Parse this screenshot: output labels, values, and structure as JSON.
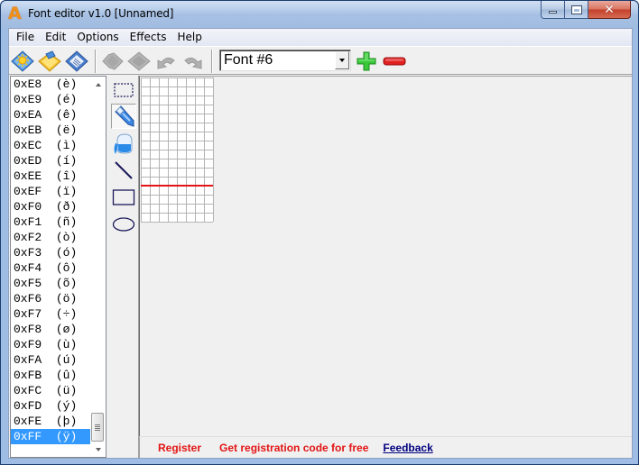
{
  "window": {
    "title": "Font editor v1.0 [Unnamed]",
    "app_icon": "letter-a-icon",
    "caption_buttons": [
      "minimize",
      "maximize",
      "close"
    ]
  },
  "menubar": {
    "items": [
      {
        "label": "File"
      },
      {
        "label": "Edit"
      },
      {
        "label": "Options"
      },
      {
        "label": "Effects"
      },
      {
        "label": "Help"
      }
    ]
  },
  "toolbar": {
    "buttons": [
      {
        "icon": "new-file-icon",
        "name": "new",
        "enabled": true
      },
      {
        "icon": "open-folder-icon",
        "name": "open",
        "enabled": true
      },
      {
        "icon": "save-disk-icon",
        "name": "save",
        "enabled": true
      },
      {
        "icon": "copy-icon",
        "name": "copy",
        "enabled": false
      },
      {
        "icon": "paste-icon",
        "name": "paste",
        "enabled": false
      },
      {
        "icon": "undo-icon",
        "name": "undo",
        "enabled": false
      },
      {
        "icon": "redo-icon",
        "name": "redo",
        "enabled": false
      }
    ],
    "font_select": {
      "value": "Font #6"
    },
    "add_font_icon": "plus-icon",
    "remove_font_icon": "minus-icon"
  },
  "char_list": {
    "items": [
      {
        "code": "0xE8",
        "char": "è"
      },
      {
        "code": "0xE9",
        "char": "é"
      },
      {
        "code": "0xEA",
        "char": "ê"
      },
      {
        "code": "0xEB",
        "char": "ë"
      },
      {
        "code": "0xEC",
        "char": "ì"
      },
      {
        "code": "0xED",
        "char": "í"
      },
      {
        "code": "0xEE",
        "char": "î"
      },
      {
        "code": "0xEF",
        "char": "ï"
      },
      {
        "code": "0xF0",
        "char": "ð"
      },
      {
        "code": "0xF1",
        "char": "ñ"
      },
      {
        "code": "0xF2",
        "char": "ò"
      },
      {
        "code": "0xF3",
        "char": "ó"
      },
      {
        "code": "0xF4",
        "char": "ô"
      },
      {
        "code": "0xF5",
        "char": "õ"
      },
      {
        "code": "0xF6",
        "char": "ö"
      },
      {
        "code": "0xF7",
        "char": "÷"
      },
      {
        "code": "0xF8",
        "char": "ø"
      },
      {
        "code": "0xF9",
        "char": "ù"
      },
      {
        "code": "0xFA",
        "char": "ú"
      },
      {
        "code": "0xFB",
        "char": "û"
      },
      {
        "code": "0xFC",
        "char": "ü"
      },
      {
        "code": "0xFD",
        "char": "ý"
      },
      {
        "code": "0xFE",
        "char": "þ"
      },
      {
        "code": "0xFF",
        "char": "ÿ"
      }
    ],
    "selected_code": "0xFF"
  },
  "tools": [
    {
      "name": "select",
      "icon": "selection-rectangle-icon",
      "active": false
    },
    {
      "name": "pencil",
      "icon": "pencil-icon",
      "active": true
    },
    {
      "name": "fill",
      "icon": "paint-bucket-icon",
      "active": false
    },
    {
      "name": "line",
      "icon": "line-icon",
      "active": false
    },
    {
      "name": "rectangle",
      "icon": "rectangle-icon",
      "active": false
    },
    {
      "name": "ellipse",
      "icon": "ellipse-icon",
      "active": false
    }
  ],
  "glyph_grid": {
    "columns": 8,
    "rows": 16,
    "baseline_row": 12,
    "baseline_color": "#e31414",
    "filled_cells": []
  },
  "statusbar": {
    "register_label": "Register",
    "get_code_label": "Get registration code for free",
    "feedback_label": "Feedback"
  },
  "colors": {
    "link_red": "#e31414",
    "link_blue": "#000080",
    "selection": "#3399ff"
  }
}
